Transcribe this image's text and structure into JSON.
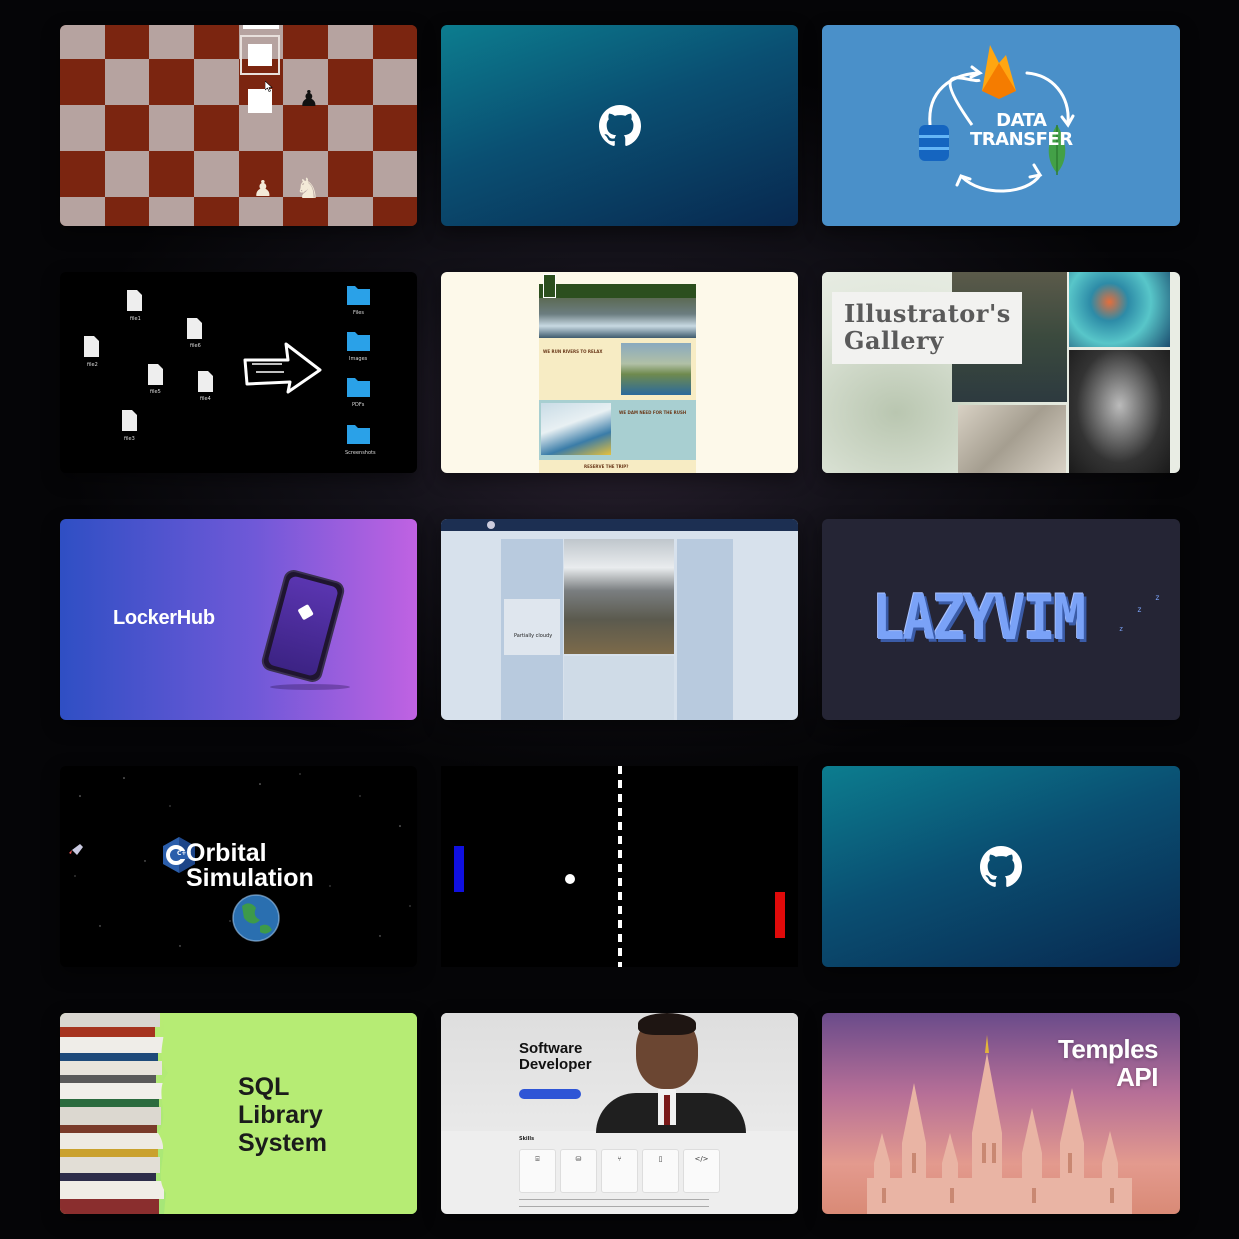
{
  "projects": [
    {
      "id": "chess",
      "icon": "chess-board"
    },
    {
      "id": "github-1",
      "icon": "github-icon"
    },
    {
      "id": "data-transfer",
      "title": "DATA TRANSFER",
      "title_lines": [
        "DATA",
        "TRANSFER"
      ],
      "icons": [
        "firebase-icon",
        "database-icon",
        "mongodb-leaf-icon"
      ]
    },
    {
      "id": "file-organizer",
      "files": [
        "file1",
        "file2",
        "file3",
        "file4",
        "file5",
        "file6"
      ],
      "folders": [
        "Files",
        "Images",
        "PDFs",
        "Screenshots"
      ]
    },
    {
      "id": "river-rafting",
      "heading1": "WE RUN RIVERS TO RELAX",
      "heading2": "WE DAM NEED FOR THE RUSH",
      "cta": "RESERVE THE TRIP?"
    },
    {
      "id": "illustrators-gallery",
      "title_lines": [
        "Illustrator's",
        "Gallery"
      ]
    },
    {
      "id": "lockerhub",
      "title": "LockerHub"
    },
    {
      "id": "utah-guide",
      "weather_text": "Partially cloudy"
    },
    {
      "id": "lazyvim",
      "title": "LAZYVIM",
      "z": "z"
    },
    {
      "id": "orbital-simulation",
      "title_lines": [
        "Orbital",
        "Simulation"
      ],
      "logo": "C++"
    },
    {
      "id": "pong",
      "paddle_left_color": "#1010e0",
      "paddle_right_color": "#e00a0a"
    },
    {
      "id": "github-2",
      "icon": "github-icon"
    },
    {
      "id": "sql-library",
      "title_lines": [
        "SQL",
        "Library",
        "System"
      ]
    },
    {
      "id": "software-developer",
      "title_lines": [
        "Software",
        "Developer"
      ],
      "skills_label": "Skills"
    },
    {
      "id": "temples-api",
      "title_lines": [
        "Temples",
        "API"
      ]
    }
  ],
  "colors": {
    "chess_light": "#b6a3a0",
    "chess_dark": "#7b2510",
    "github_gradient": [
      "#0c7d8f",
      "#08284f"
    ],
    "lazyvim_blue": "#7aa2f7"
  }
}
